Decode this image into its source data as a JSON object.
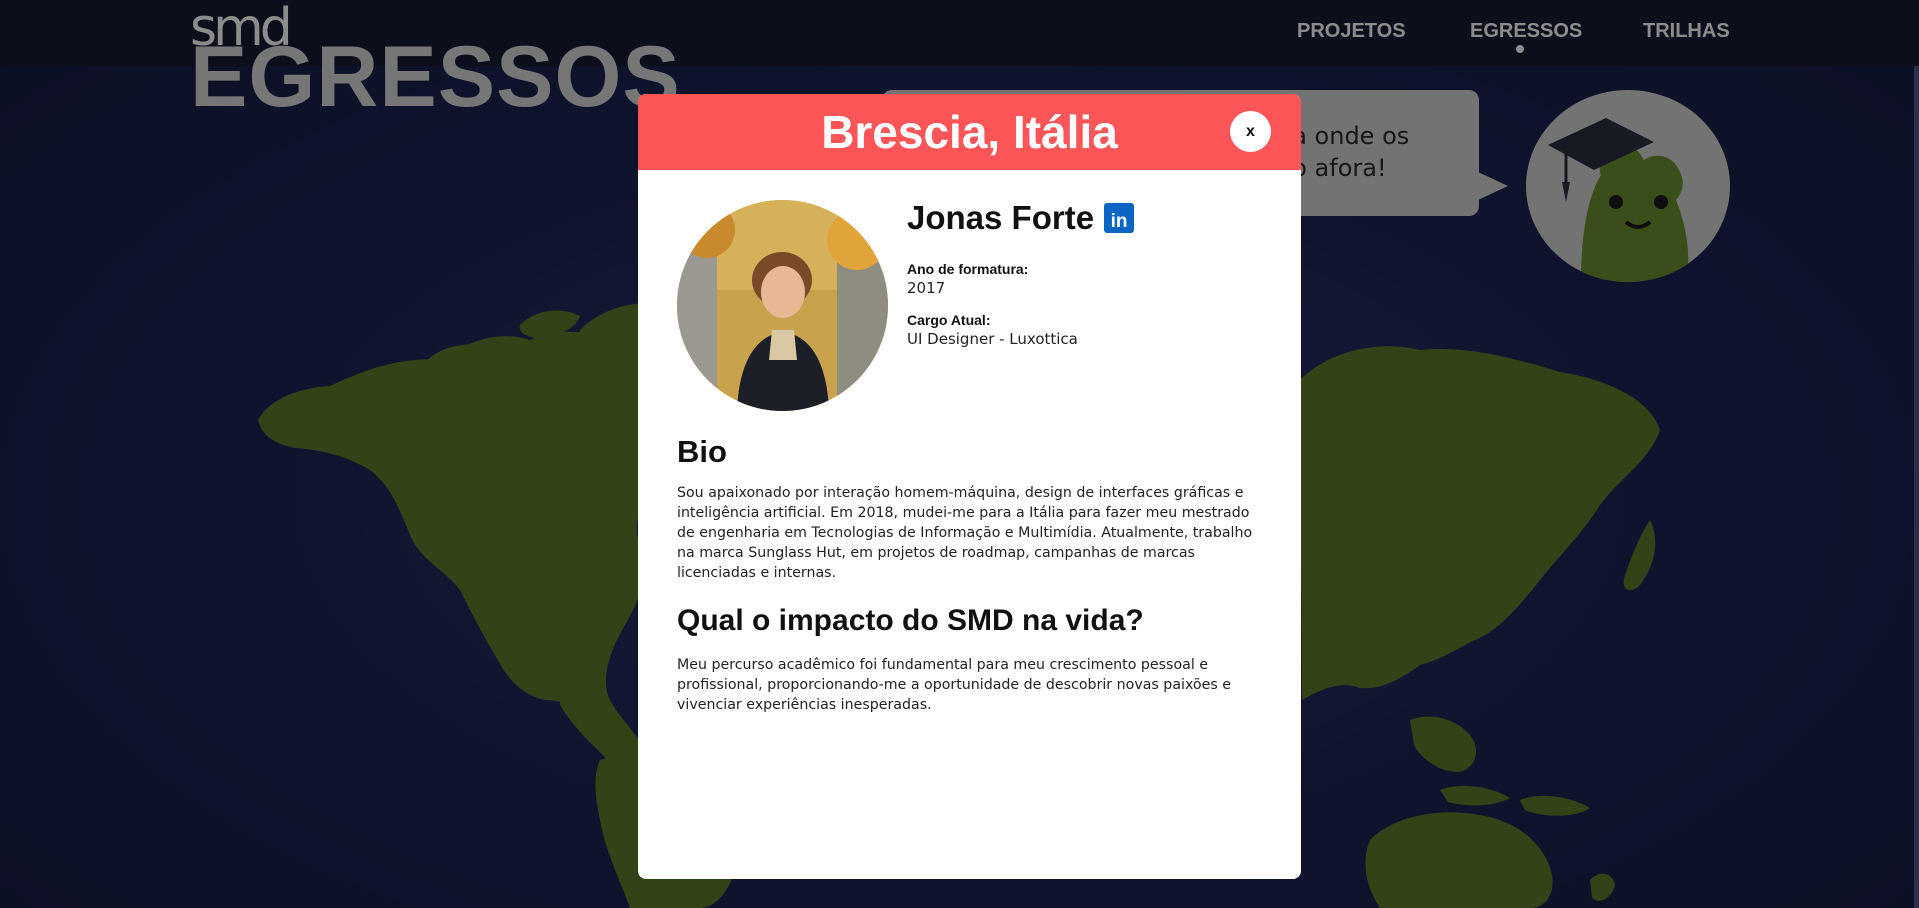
{
  "nav": {
    "logo": "smd",
    "links": [
      "PROJETOS",
      "EGRESSOS",
      "TRILHAS"
    ],
    "active_link": "EGRESSOS"
  },
  "page": {
    "title": "EGRESSOS",
    "bubble_text": "ha onde os do afora!",
    "bubble_lines": [
      "ha onde os",
      "do afora!"
    ]
  },
  "modal": {
    "location": "Brescia, Itália",
    "close_label": "x",
    "profile": {
      "name": "Jonas Forte",
      "linkedin_icon": "in",
      "grad_year_label": "Ano de formatura:",
      "grad_year": "2017",
      "role_label": "Cargo Atual:",
      "role": "UI Designer - Luxottica"
    },
    "bio_title": "Bio",
    "bio_text": "Sou apaixonado por interação homem-máquina, design de interfaces gráficas e inteligência artificial. Em 2018, mudei-me para a Itália para fazer meu mestrado de engenharia em Tecnologias de Informação e Multimídia. Atualmente, trabalho na marca Sunglass Hut, em projetos de roadmap, campanhas de marcas licenciadas e internas.",
    "impact_title": "Qual o impacto do SMD na vida?",
    "impact_text": "Meu percurso acadêmico foi fundamental para meu crescimento pessoal e profissional, proporcionando-me a oportunidade de descobrir novas paixões e vivenciar experiências inesperadas."
  },
  "colors": {
    "background": "#1e2757",
    "continents": "#5c7a2c",
    "modal_header": "#fb5558",
    "linkedin": "#0a66c2"
  }
}
